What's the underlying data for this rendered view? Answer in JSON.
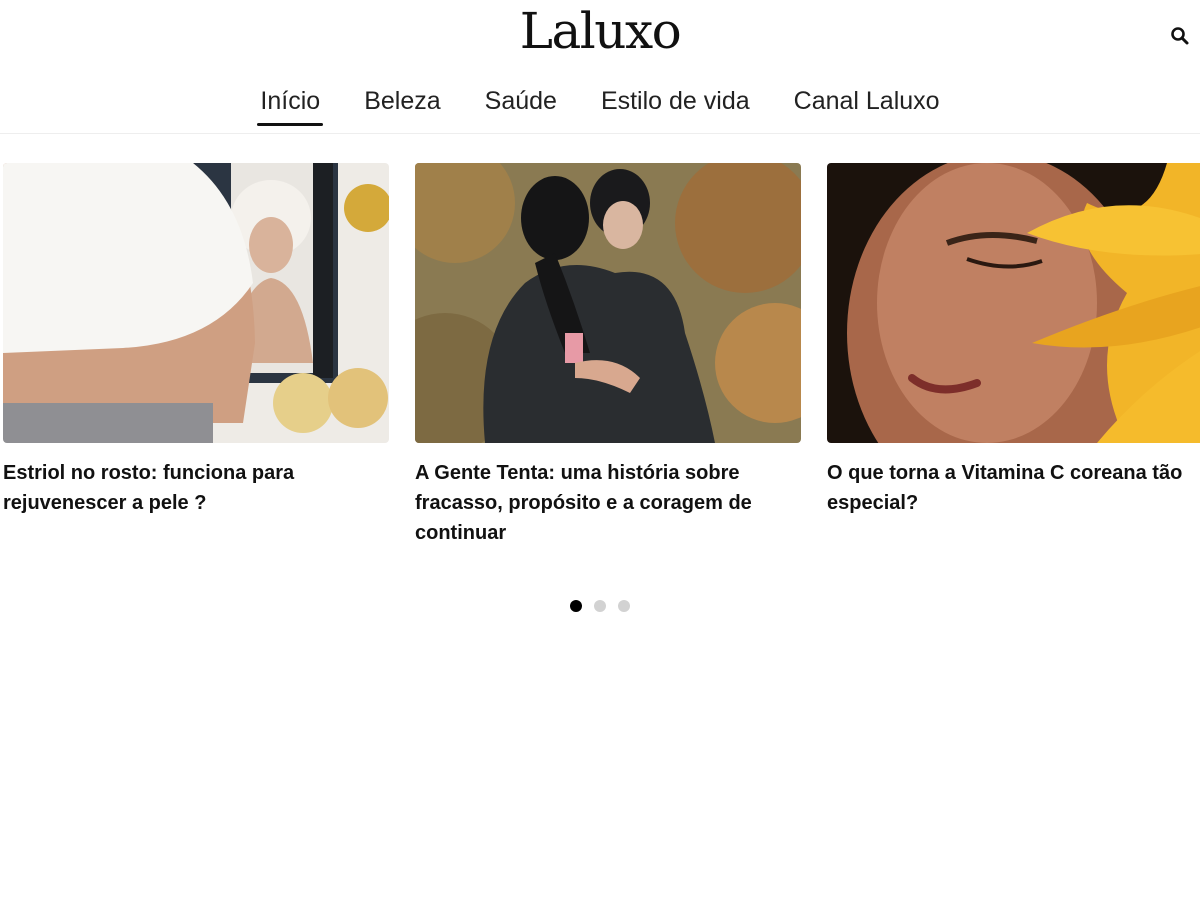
{
  "header": {
    "logo": "Laluxo",
    "search_icon": "search-icon"
  },
  "nav": {
    "items": [
      "Início",
      "Beleza",
      "Saúde",
      "Estilo de vida",
      "Canal Laluxo"
    ],
    "active_index": 0
  },
  "carousel": {
    "cards": [
      {
        "title": "Estriol no rosto: funciona para rejuvenescer a pele ?"
      },
      {
        "title": "A Gente Tenta: uma história sobre fracasso, propósito e a coragem de continuar"
      },
      {
        "title": "O que torna a Vitamina C coreana tão especial?"
      }
    ],
    "dots_count": 3,
    "active_dot": 0
  },
  "colors": {
    "text": "#111111",
    "dot_inactive": "#d2d2d2",
    "dot_active": "#000000"
  }
}
